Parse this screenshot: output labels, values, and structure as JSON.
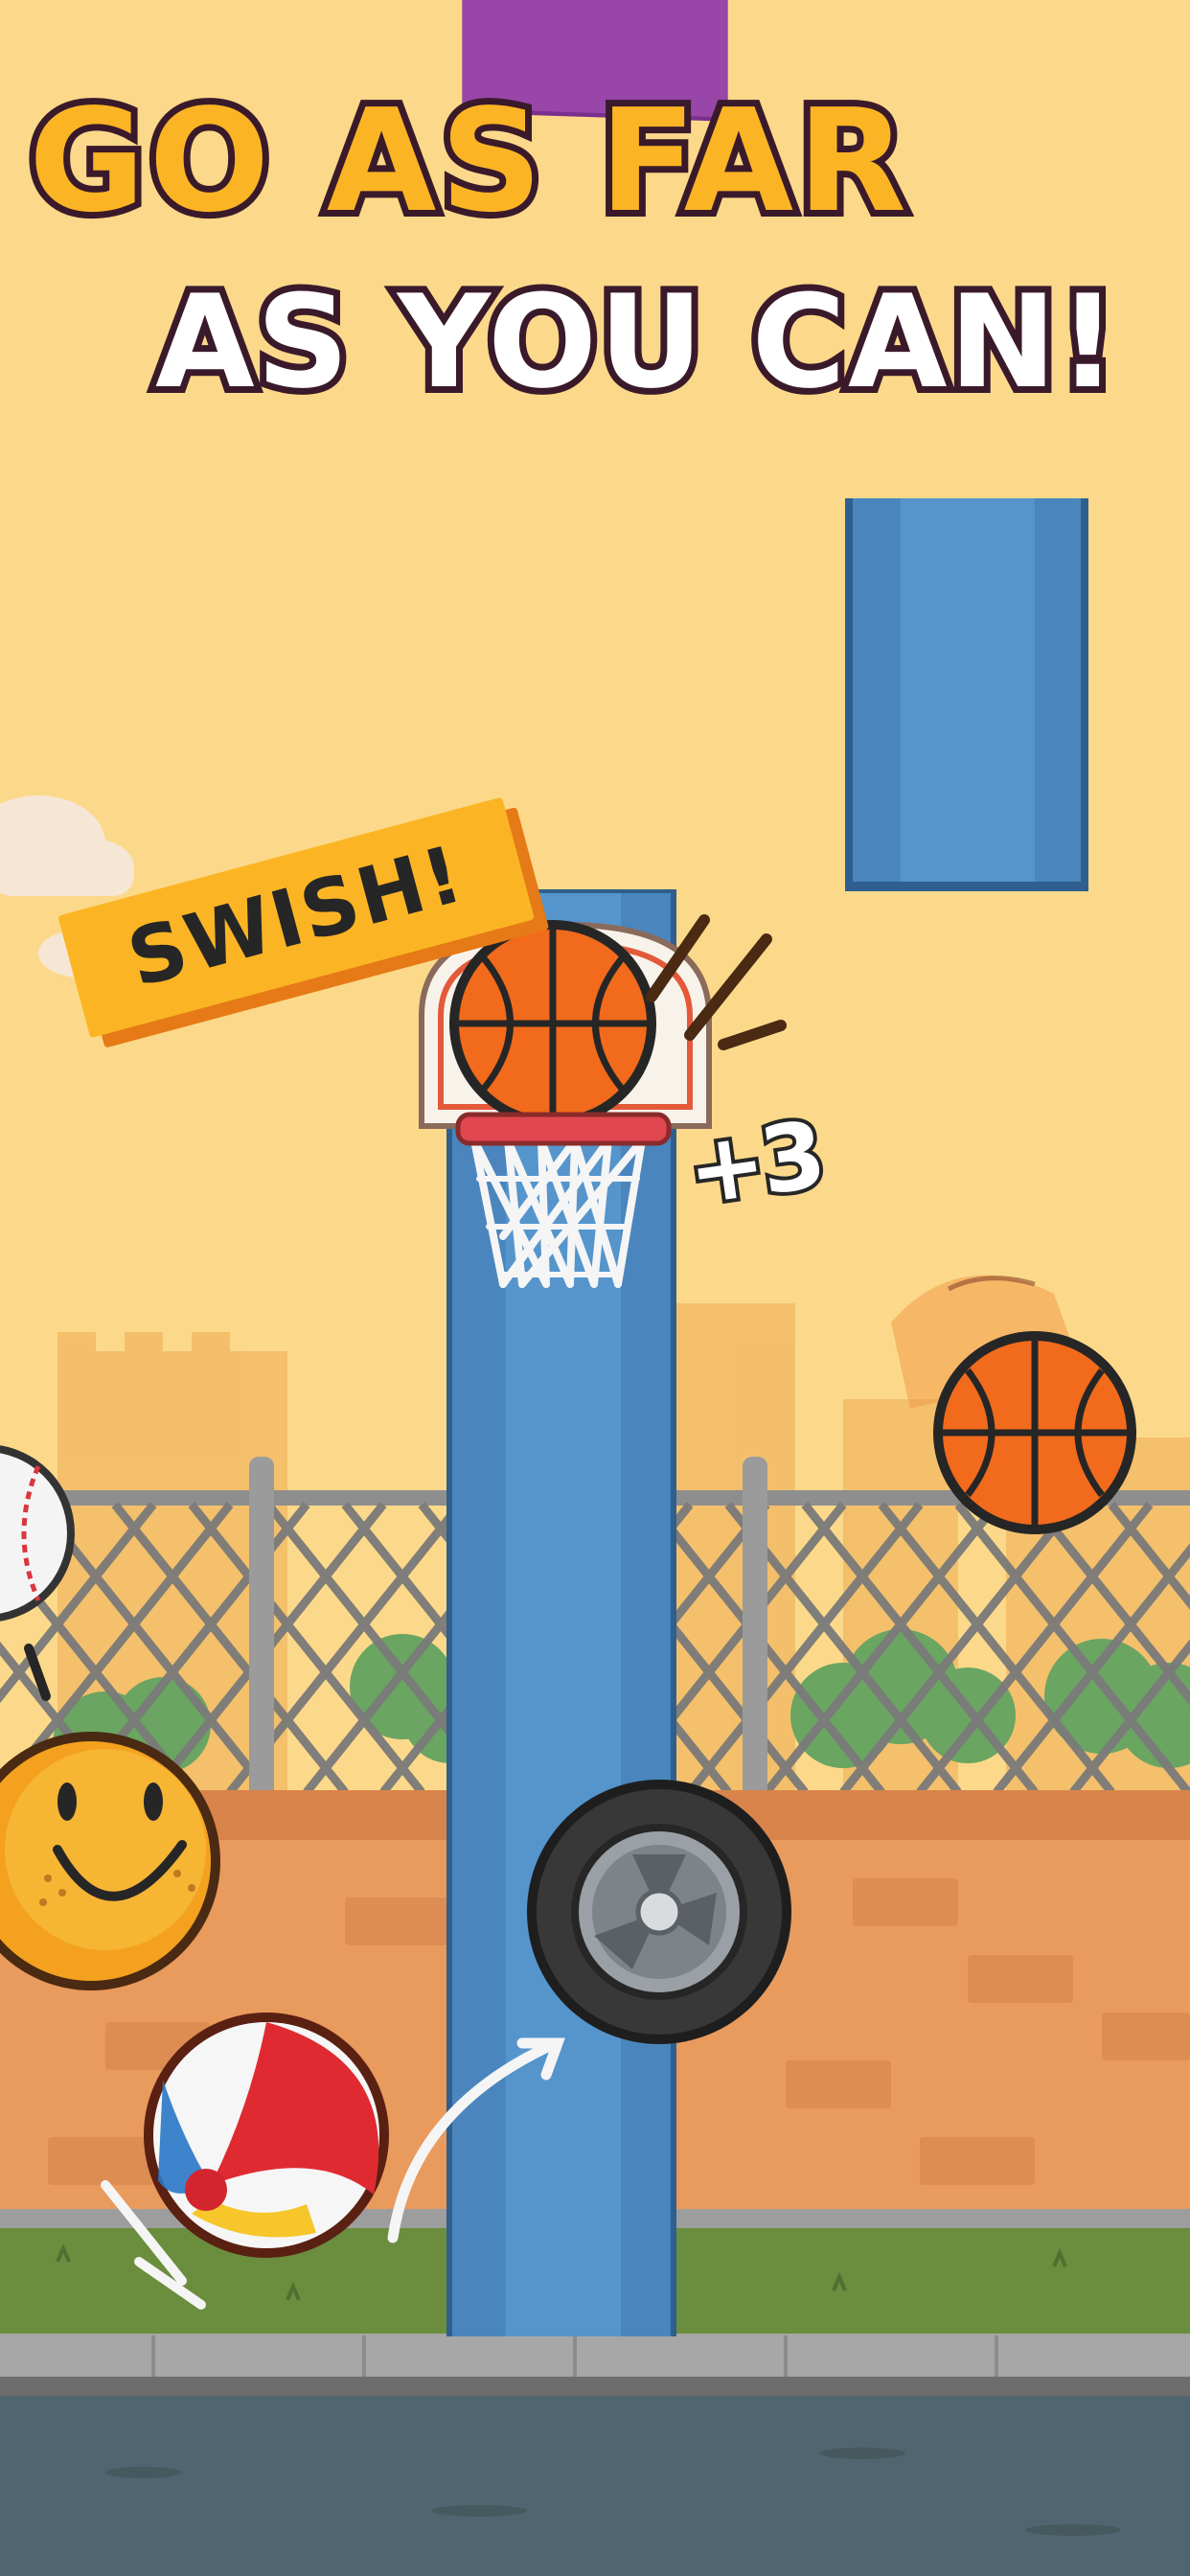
{
  "banner": {
    "line1": "GO AS FAR",
    "line2": "AS YOU CAN!",
    "colors": {
      "background": "#9846a8",
      "line1_fill": "#fbb524",
      "line2_fill": "#ffffff",
      "outline": "#3a1a2a"
    }
  },
  "popups": {
    "swish": "SWISH!",
    "score": "+3"
  },
  "scene": {
    "balls": [
      "basketball-in-hoop",
      "basketball-flying",
      "baseball",
      "smiley-ball",
      "tire",
      "beach-ball"
    ],
    "colors": {
      "sky": "#fcd98a",
      "pole": "#4a86bd",
      "wall": "#e99a5d",
      "fence": "#8c8c8c",
      "grass": "#6a8d3e",
      "road": "#4f6670"
    }
  }
}
